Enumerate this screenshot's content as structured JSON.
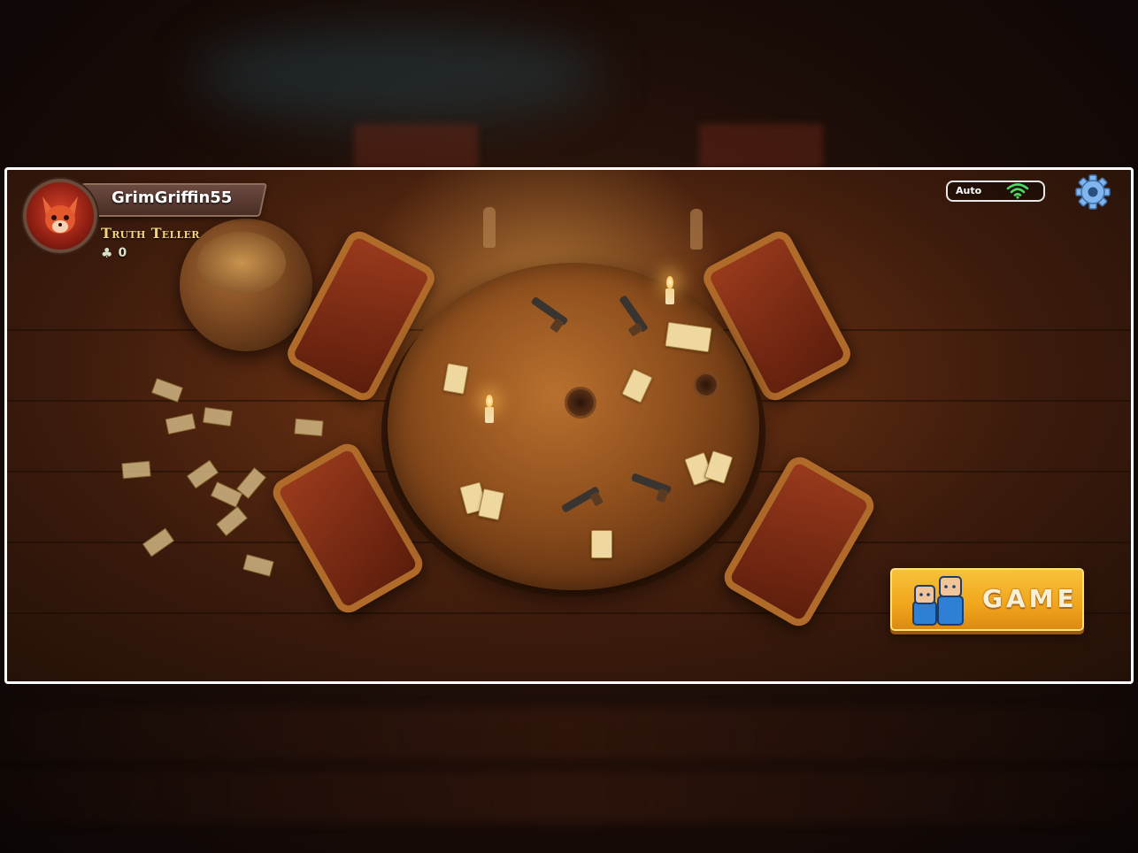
{
  "player": {
    "username": "GrimGriffin55",
    "title": "Truth Teller",
    "clover_count": "0"
  },
  "network": {
    "mode_label": "Auto",
    "signal": "strong"
  },
  "game_button": {
    "label": "GAME"
  },
  "colors": {
    "accent_gold": "#f0a51c",
    "title_gold": "#f3d47a",
    "wifi_green": "#4cd964",
    "gear_blue": "#6aa9e8"
  },
  "icons": {
    "avatar": "fox-avatar",
    "clover": "clover-icon",
    "wifi": "wifi-icon",
    "settings": "gear-icon",
    "game": "players-icon"
  }
}
